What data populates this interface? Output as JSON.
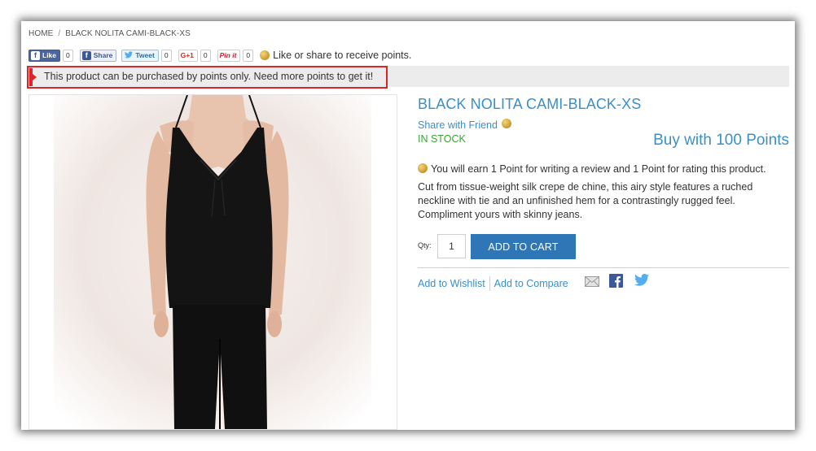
{
  "breadcrumb": {
    "home": "HOME",
    "separator": "/",
    "current": "BLACK NOLITA CAMI-BLACK-XS"
  },
  "social": {
    "like_label": "Like",
    "like_count": "0",
    "share_label": "Share",
    "tweet_label": "Tweet",
    "tweet_count": "0",
    "gplus_label": "G+1",
    "gplus_count": "0",
    "pin_label": "Pin it",
    "pin_count": "0",
    "message": "Like or share to receive points."
  },
  "notice": {
    "text": "This product can be purchased by points only. Need more points to get it!"
  },
  "product": {
    "name": "BLACK NOLITA CAMI-BLACK-XS",
    "share_with_friend": "Share with Friend",
    "stock": "IN STOCK",
    "buy_with_points": "Buy with 100 Points",
    "earn_text": "You will earn 1 Point for writing a review and 1 Point for rating this product.",
    "description": "Cut from tissue-weight silk crepe de chine, this airy style features a ruched neckline with tie and an unfinished hem for a contrastingly rugged feel. Compliment yours with skinny jeans."
  },
  "cart": {
    "qty_label": "Qty:",
    "qty_value": "1",
    "add_to_cart": "ADD TO CART"
  },
  "actions": {
    "wishlist": "Add to Wishlist",
    "compare": "Add to Compare"
  },
  "colors": {
    "link": "#3a8fc7",
    "in_stock": "#3aa636",
    "cart_button": "#2e76b5",
    "notice_border": "#d9262b"
  }
}
